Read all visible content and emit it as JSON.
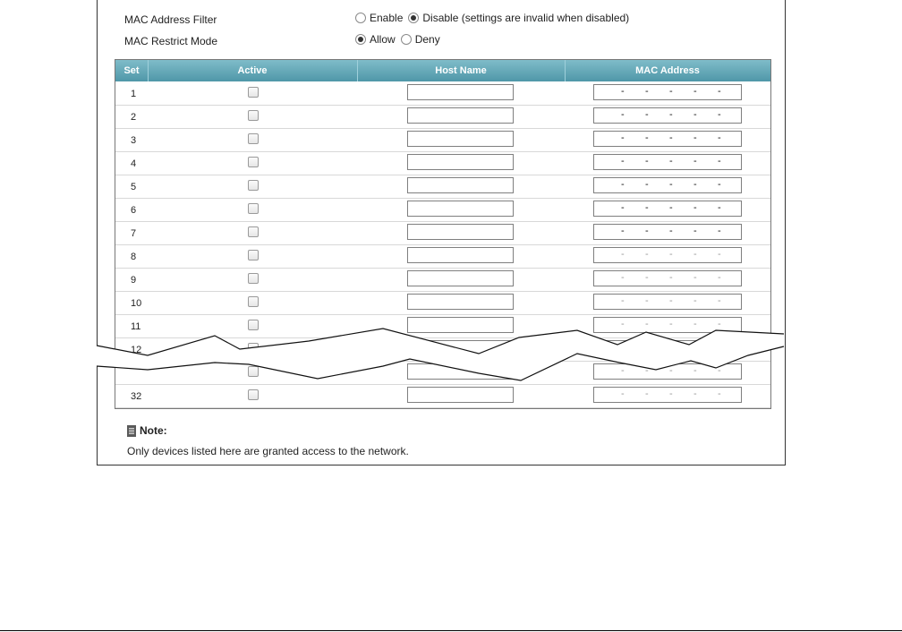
{
  "filter": {
    "label": "MAC Address Filter",
    "enable_label": "Enable",
    "disable_label": "Disable (settings are invalid when disabled)",
    "selected": "Disable"
  },
  "restrict": {
    "label": "MAC Restrict Mode",
    "allow_label": "Allow",
    "deny_label": "Deny",
    "selected": "Allow"
  },
  "table": {
    "columns": [
      "Set",
      "Active",
      "Host Name",
      "MAC Address"
    ],
    "rows": [
      {
        "set": "1",
        "active": false,
        "host": "",
        "mac_enabled": true
      },
      {
        "set": "2",
        "active": false,
        "host": "",
        "mac_enabled": true
      },
      {
        "set": "3",
        "active": false,
        "host": "",
        "mac_enabled": true
      },
      {
        "set": "4",
        "active": false,
        "host": "",
        "mac_enabled": true
      },
      {
        "set": "5",
        "active": false,
        "host": "",
        "mac_enabled": true
      },
      {
        "set": "6",
        "active": false,
        "host": "",
        "mac_enabled": true
      },
      {
        "set": "7",
        "active": false,
        "host": "",
        "mac_enabled": true
      },
      {
        "set": "8",
        "active": false,
        "host": "",
        "mac_enabled": false
      },
      {
        "set": "9",
        "active": false,
        "host": "",
        "mac_enabled": false
      },
      {
        "set": "10",
        "active": false,
        "host": "",
        "mac_enabled": false
      },
      {
        "set": "11",
        "active": false,
        "host": "",
        "mac_enabled": false
      },
      {
        "set": "12",
        "active": false,
        "host": "",
        "mac_enabled": false
      },
      {
        "set": "",
        "active": false,
        "host": "",
        "mac_enabled": false
      },
      {
        "set": "32",
        "active": false,
        "host": "",
        "mac_enabled": false
      }
    ],
    "mac_separator": "-"
  },
  "note": {
    "title": "Note:",
    "text": "Only devices listed here are granted access to the network."
  },
  "colors": {
    "header_top": "#7fbcc9",
    "header_bottom": "#4f97a8"
  }
}
